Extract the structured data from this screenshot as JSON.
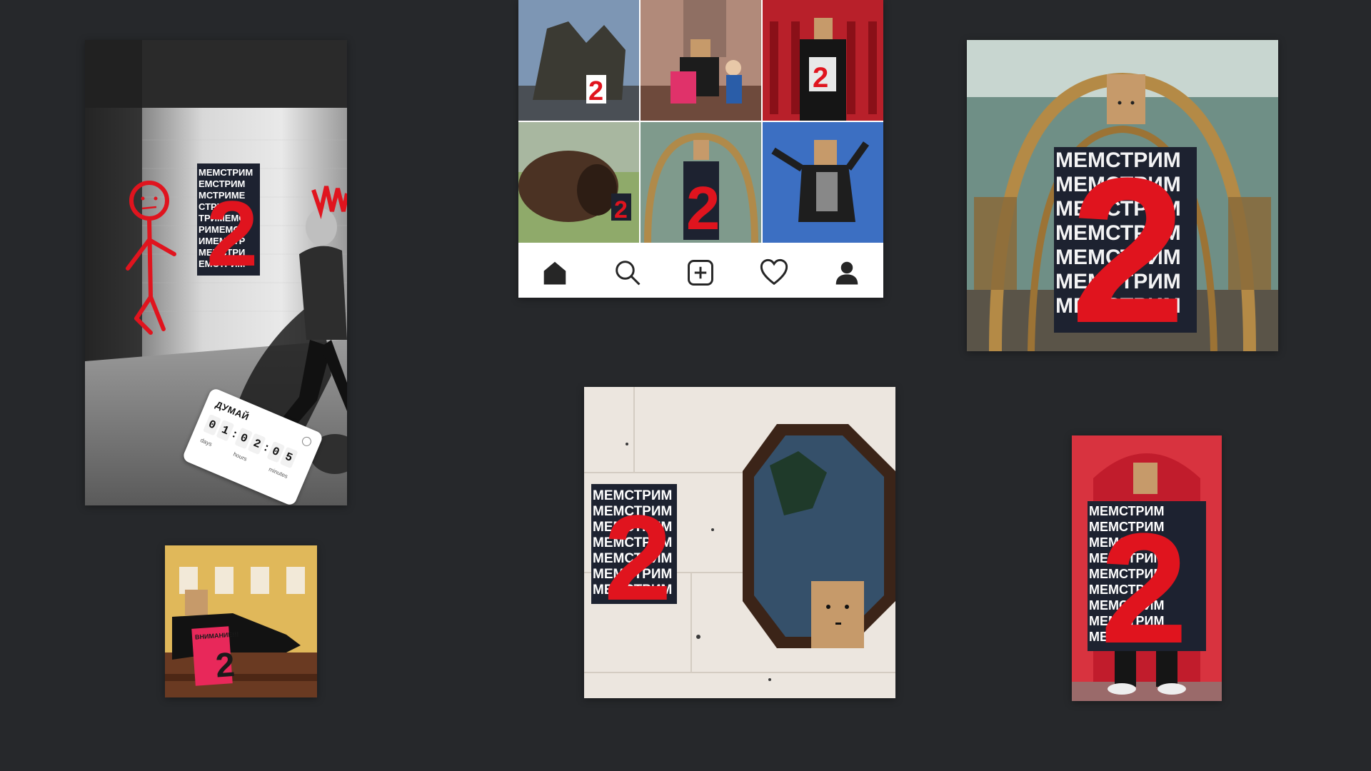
{
  "story": {
    "poster_number": "2",
    "countdown": {
      "title": "ДУМАЙ",
      "digits": [
        "0",
        "1",
        "0",
        "2",
        "0",
        "5"
      ],
      "labels": {
        "days": "days",
        "hours": "hours",
        "minutes": "minutes"
      }
    }
  },
  "feed": {
    "tabs": [
      {
        "icon": "home-icon"
      },
      {
        "icon": "search-icon"
      },
      {
        "icon": "add-post-icon"
      },
      {
        "icon": "heart-icon"
      },
      {
        "icon": "profile-icon"
      }
    ]
  },
  "poster_text": "МЕМСТРИМ",
  "bench_sign": {
    "headline": "ВНИМАНИЕ!!!",
    "number": "2"
  },
  "colors": {
    "background": "#26282b",
    "accent_red": "#e0141e",
    "poster_dark": "#1d2230"
  }
}
